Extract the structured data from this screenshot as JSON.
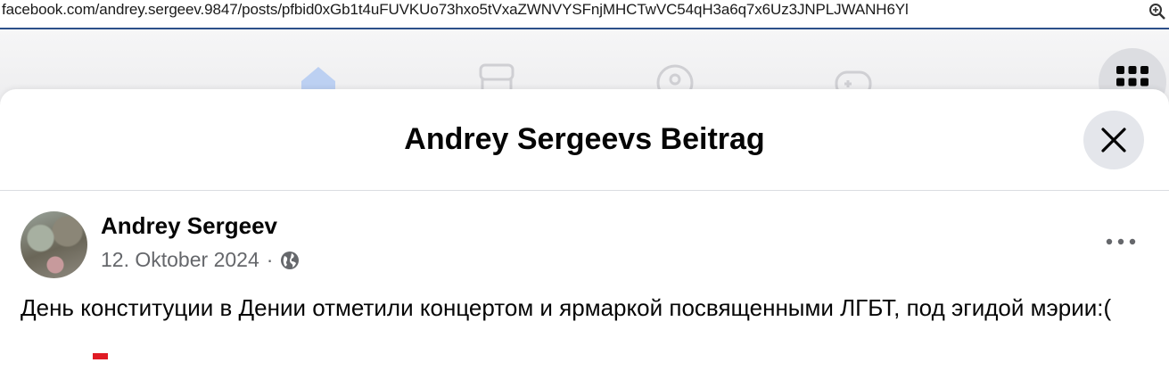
{
  "browser": {
    "url": "facebook.com/andrey.sergeev.9847/posts/pfbid0xGb1t4uFUVKUo73hxo5tVxaZWNVYSFnjMHCTwVC54qH3a6q7x6Uz3JNPLJWANH6Yl"
  },
  "dialog": {
    "title": "Andrey Sergeevs Beitrag"
  },
  "post": {
    "author": "Andrey Sergeev",
    "date": "12. Oktober 2024",
    "separator": "·",
    "audience_icon": "globe-icon",
    "text": "День конституции в Дении отметили концертом и ярмаркой посвященными ЛГБТ, под эгидой мэрии:("
  },
  "colors": {
    "accent": "#1877f2",
    "text": "#050505",
    "secondary_text": "#65676b",
    "button_bg": "#e4e6eb"
  }
}
